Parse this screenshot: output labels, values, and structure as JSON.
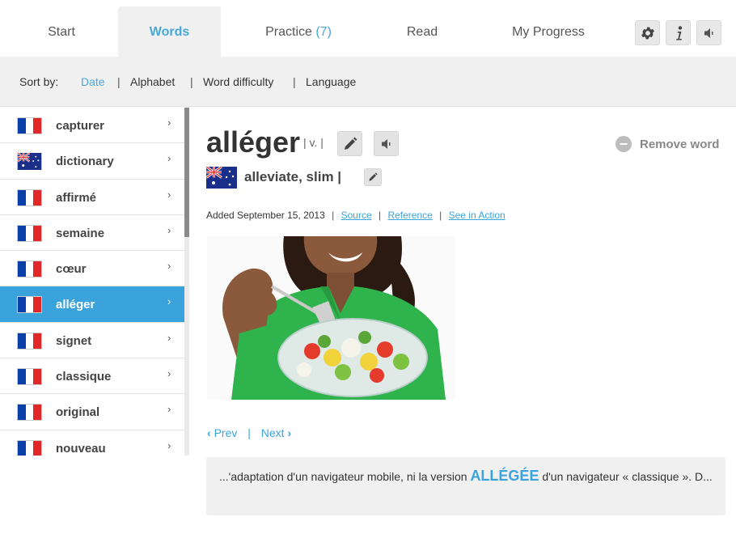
{
  "tabs": [
    {
      "label": "Start"
    },
    {
      "label": "Words",
      "active": true
    },
    {
      "label": "Practice",
      "count": "(7)"
    },
    {
      "label": "Read"
    },
    {
      "label": "My Progress"
    }
  ],
  "toolbar_icons": [
    "gear-icon",
    "info-icon",
    "speaker-icon"
  ],
  "sort": {
    "label": "Sort by:",
    "options": [
      "Date",
      "Alphabet",
      "Word difficulty",
      "Language"
    ],
    "active": "Date",
    "separator": "|"
  },
  "words": [
    {
      "label": "capturer",
      "flag": "fr"
    },
    {
      "label": "dictionary",
      "flag": "au"
    },
    {
      "label": "affirmé",
      "flag": "fr"
    },
    {
      "label": "semaine",
      "flag": "fr"
    },
    {
      "label": "cœur",
      "flag": "fr"
    },
    {
      "label": "alléger",
      "flag": "fr",
      "active": true
    },
    {
      "label": "signet",
      "flag": "fr"
    },
    {
      "label": "classique",
      "flag": "fr"
    },
    {
      "label": "original",
      "flag": "fr"
    },
    {
      "label": "nouveau",
      "flag": "fr"
    }
  ],
  "chevron": "›",
  "detail": {
    "word": "alléger",
    "pos": "| v. |",
    "remove_label": "Remove word",
    "translation": "alleviate, slim |",
    "added": "Added September 15, 2013",
    "sep": "|",
    "links": {
      "source": "Source",
      "reference": "Reference",
      "see_in_action": "See in Action"
    },
    "pager": {
      "prev": "Prev",
      "next": "Next",
      "sep": "|"
    },
    "context": {
      "before": "...'adaptation d'un navigateur mobile, ni la version ",
      "highlight": "ALLÉGÉE",
      "after": " d'un navigateur « classique ». D..."
    }
  },
  "colors": {
    "accent": "#3aa3dc",
    "tab_active_bg": "#f0f0f0",
    "sortbar_bg": "#f0f0f0"
  }
}
